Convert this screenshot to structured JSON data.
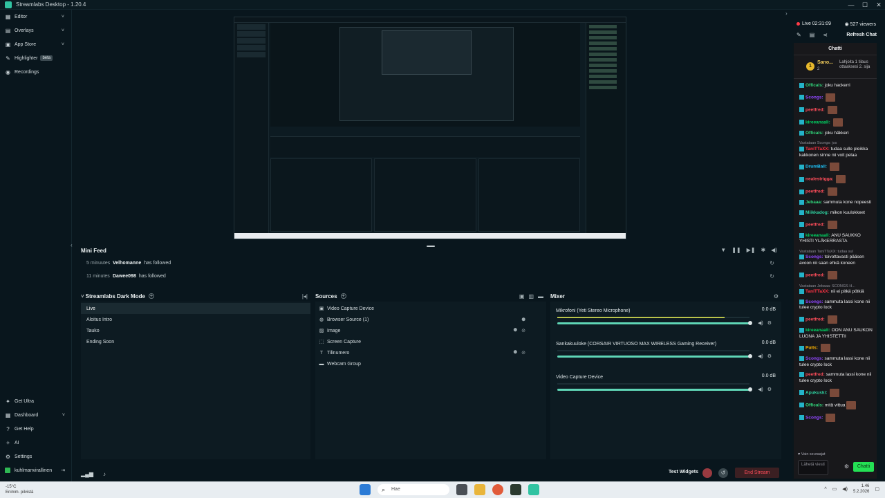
{
  "window": {
    "title": "Streamlabs Desktop - 1.20.4",
    "controls": [
      "—",
      "☐",
      "✕"
    ]
  },
  "sidebar": {
    "top": [
      {
        "label": "Editor",
        "icon": "editor-icon",
        "glyph": "▦",
        "expandable": true
      },
      {
        "label": "Overlays",
        "icon": "overlays-icon",
        "glyph": "▤",
        "expandable": true
      },
      {
        "label": "App Store",
        "icon": "app-store-icon",
        "glyph": "▣",
        "expandable": true
      },
      {
        "label": "Highlighter",
        "icon": "highlighter-icon",
        "glyph": "✎",
        "badge": "beta"
      },
      {
        "label": "Recordings",
        "icon": "recordings-icon",
        "glyph": "◉"
      }
    ],
    "bottom": [
      {
        "label": "Get Ultra",
        "icon": "ultra-icon",
        "glyph": "✦"
      },
      {
        "label": "Dashboard",
        "icon": "dashboard-icon",
        "glyph": "▦",
        "expandable": true
      },
      {
        "label": "Get Help",
        "icon": "help-icon",
        "glyph": "?"
      },
      {
        "label": "AI",
        "icon": "ai-icon",
        "glyph": "✧"
      },
      {
        "label": "Settings",
        "icon": "gear-icon",
        "glyph": "⚙"
      }
    ],
    "user": {
      "name": "kuhlmanvirallinen",
      "logout_glyph": "⇥"
    }
  },
  "minifeed": {
    "title": "Mini Feed",
    "items": [
      {
        "time": "5 minuutes",
        "user": "Velhomanne",
        "action": "has followed"
      },
      {
        "time": "11 minutes",
        "user": "Dawee098",
        "action": "has followed"
      }
    ]
  },
  "scenes": {
    "title": "Streamlabs Dark Mode",
    "items": [
      "Live",
      "Aloitus Intro",
      "Tauko",
      "Ending Soon"
    ],
    "active_index": 0
  },
  "sources": {
    "title": "Sources",
    "items": [
      {
        "label": "Video Capture Device",
        "icon": "camera-icon",
        "glyph": "▣"
      },
      {
        "label": "Browser Source (1)",
        "icon": "globe-icon",
        "glyph": "◍"
      },
      {
        "label": "Image",
        "icon": "image-icon",
        "glyph": "▨",
        "lock": true,
        "hidden": true
      },
      {
        "label": "Screen Capture",
        "icon": "screen-capture-icon",
        "glyph": "⬚"
      },
      {
        "label": "Tilinumero",
        "icon": "text-icon",
        "glyph": "T",
        "lock": true,
        "hidden": true
      },
      {
        "label": "Webcam Group",
        "icon": "folder-icon",
        "glyph": "▬"
      }
    ]
  },
  "mixer": {
    "title": "Mixer",
    "channels": [
      {
        "name": "Mikrofoni (Yeti Stereo Microphone)",
        "db": "0.0 dB",
        "level": 0.87
      },
      {
        "name": "Sankakuuloke (CORSAIR VIRTUOSO MAX WIRELESS Gaming Receiver)",
        "db": "0.0 dB",
        "level": 0
      },
      {
        "name": "Video Capture Device",
        "db": "0.0 dB",
        "level": 0
      }
    ]
  },
  "footer": {
    "test_widgets": "Test Widgets",
    "end_stream": "End Stream"
  },
  "chat": {
    "live_label": "Live 02:31:09",
    "viewers": "527 viewers",
    "refresh": "Refresh Chat",
    "title": "Chatti",
    "pinned": {
      "name": "Sano...",
      "rank": "2",
      "text": "Lahjoita 1 tilaus ottaaksesi 2. sija"
    },
    "messages": [
      {
        "user": "Officals:",
        "color": "#31d67b",
        "text": "joku hackerri"
      },
      {
        "user": "Scongs:",
        "color": "#9147ff",
        "text": "",
        "emote": true
      },
      {
        "user": "peetfred:",
        "color": "#ff4d5a",
        "text": "",
        "emote": true
      },
      {
        "user": "kireeanaali:",
        "color": "#00d563",
        "text": "",
        "emote": true
      },
      {
        "user": "Officals:",
        "color": "#31d67b",
        "text": "joku häkkeri"
      },
      {
        "reply": "Vastataan Scongs: jos",
        "user": "TaniTTaXX:",
        "color": "#ff3344",
        "text": "tudaa sulle pleikka kakkonen sinne nii voit pelaa"
      },
      {
        "user": "DrumBall:",
        "color": "#1ec8ff",
        "text": "",
        "emote": true
      },
      {
        "user": "nealestrigga:",
        "color": "#ff4d5a",
        "text": "",
        "emote": true
      },
      {
        "user": "peetfred:",
        "color": "#ff4d5a",
        "text": "",
        "emote": true
      },
      {
        "user": "Jebaaa:",
        "color": "#31d67b",
        "text": "sammuta kone nopeesti"
      },
      {
        "user": "Miikkadog:",
        "color": "#2ed1a0",
        "text": "mikon kuulokkeet"
      },
      {
        "user": "peetfred:",
        "color": "#ff4d5a",
        "text": "",
        "emote": true
      },
      {
        "user": "kireeanaali:",
        "color": "#00d563",
        "text": "ANU SAUKKO YHISTI YLÄKERRASTA"
      },
      {
        "reply": "Vastataan TaniTTaXX: tudaa sul",
        "user": "Scongs:",
        "color": "#9147ff",
        "text": "toivottavasti pääsen avoon nii saan ehkä koneen"
      },
      {
        "user": "peetfred:",
        "color": "#ff4d5a",
        "text": "",
        "emote": true
      },
      {
        "reply": "Vastataan Jebaaa: SCONGS H...",
        "user": "TaniTTaXX:",
        "color": "#ff3344",
        "text": "nii ei pitkä pötkiä"
      },
      {
        "user": "Scongs:",
        "color": "#9147ff",
        "text": "sammuta lassi kone nii tulee crypto lock"
      },
      {
        "user": "peetfred:",
        "color": "#ff4d5a",
        "text": "",
        "emote": true
      },
      {
        "user": "kireeanaali:",
        "color": "#00d563",
        "text": "OON ANU SAUKON LUONA JA YHISTETTII"
      },
      {
        "user": "Puits:",
        "color": "#ffb400",
        "text": "",
        "emote": true
      },
      {
        "user": "Scongs:",
        "color": "#9147ff",
        "text": "sammuta lassi kone nii tulee crypto lock"
      },
      {
        "user": "peetfred:",
        "color": "#ff4d5a",
        "text": "sammuta lassi kone nii tulee crypto lock"
      },
      {
        "user": "Apukuski:",
        "color": "#2ed1a0",
        "text": "",
        "emote": true
      },
      {
        "user": "Officals:",
        "color": "#31d67b",
        "text": "mitä vittua",
        "emote": true
      },
      {
        "user": "Scongs:",
        "color": "#9147ff",
        "text": "",
        "emote": true
      }
    ],
    "followers_only": "Vain seuraajat",
    "input_placeholder": "Lähetä viesti",
    "send": "Chatti"
  },
  "taskbar": {
    "weather_temp": "-15°C",
    "weather_text": "Enimm. pilvistä",
    "search": "Hae",
    "time": "1.46",
    "date": "5.2.2026"
  },
  "colors": {
    "accent": "#31c3a2",
    "live": "#ff3b47",
    "chat_send": "#24e054",
    "end_stream_text": "#ff4d5a"
  }
}
